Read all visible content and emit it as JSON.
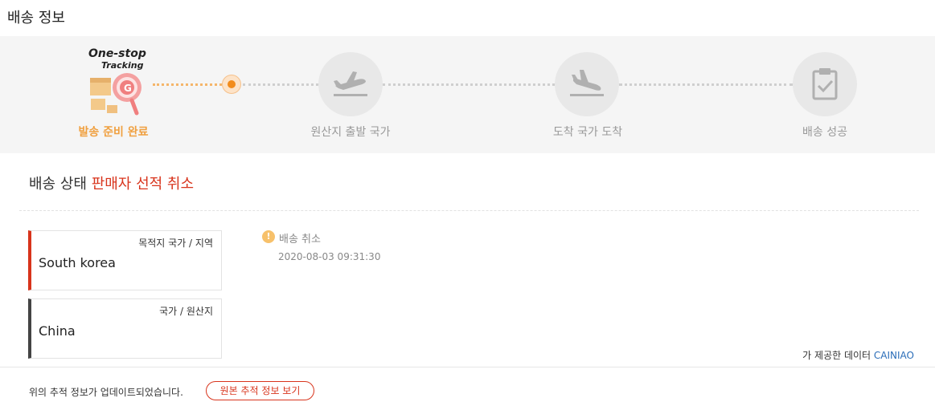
{
  "page": {
    "title": "배송 정보"
  },
  "tracker": {
    "logo": {
      "line1": "One-stop",
      "line2": "Tracking"
    },
    "steps": [
      {
        "label": "발송 준비 완료",
        "icon": "parcel-magnifier-icon",
        "active": true
      },
      {
        "label": "원산지 출발 국가",
        "icon": "plane-takeoff-icon",
        "active": false
      },
      {
        "label": "도착 국가 도착",
        "icon": "plane-landing-icon",
        "active": false
      },
      {
        "label": "배송 성공",
        "icon": "clipboard-check-icon",
        "active": false
      }
    ],
    "colors": {
      "active": "#f0a040",
      "inactive": "#999999",
      "current_dot": "#f28c1c"
    }
  },
  "status": {
    "prefix": "배송 상태 ",
    "value": "판매자 선적 취소",
    "value_color": "#d8341c"
  },
  "locations": {
    "destination": {
      "label": "목적지 국가 / 지역",
      "value": "South korea"
    },
    "origin": {
      "label": "국가 / 원산지",
      "value": "China"
    }
  },
  "events": [
    {
      "icon": "exclamation-icon",
      "title": "배송 취소",
      "time": "2020-08-03 09:31:30"
    }
  ],
  "provider": {
    "text": "가 제공한 데이터 ",
    "name": "CAINIAO"
  },
  "footer": {
    "message": "위의 추적 정보가 업데이트되었습니다.",
    "button_label": "원본 추적 정보 보기"
  }
}
